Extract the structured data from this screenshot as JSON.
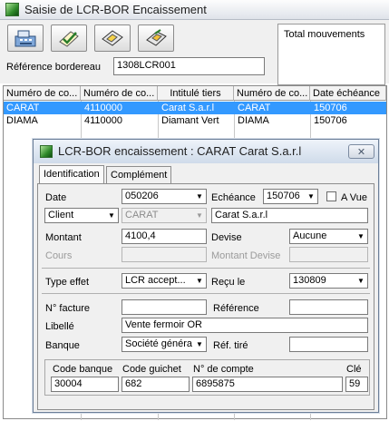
{
  "window": {
    "title": "Saisie de LCR-BOR Encaissement"
  },
  "toolbar": {
    "buttons": [
      {
        "icon": "cash-register-icon"
      },
      {
        "icon": "check-validate-icon"
      },
      {
        "icon": "diskette-icon"
      },
      {
        "icon": "print-icon"
      }
    ],
    "total_label": "Total mouvements"
  },
  "reference": {
    "label": "Référence bordereau",
    "value": "1308LCR001"
  },
  "grid": {
    "columns": [
      "Numéro de co...",
      "Numéro de co...",
      "Intitulé tiers",
      "Numéro de co...",
      "Date échéance"
    ],
    "rows": [
      {
        "cells": [
          "CARAT",
          "4110000",
          "Carat S.a.r.l",
          "CARAT",
          "150706"
        ],
        "selected": true
      },
      {
        "cells": [
          "DIAMA",
          "4110000",
          "Diamant Vert",
          "DIAMA",
          "150706"
        ],
        "selected": false
      }
    ]
  },
  "dialog": {
    "title": "LCR-BOR encaissement : CARAT Carat S.a.r.l",
    "close_label": "✕",
    "tabs": [
      {
        "label": "Identification",
        "active": true
      },
      {
        "label": "Complément",
        "active": false
      }
    ],
    "fields": {
      "date_label": "Date",
      "date_value": "050206",
      "echeance_label": "Echéance",
      "echeance_value": "150706",
      "a_vue_label": "A Vue",
      "a_vue_checked": false,
      "tiers_type": "Client",
      "tiers_code": "CARAT",
      "tiers_name": "Carat S.a.r.l",
      "montant_label": "Montant",
      "montant_value": "4100,4",
      "devise_label": "Devise",
      "devise_value": "Aucune",
      "cours_label": "Cours",
      "cours_value": "",
      "montant_devise_label": "Montant Devise",
      "montant_devise_value": "",
      "type_effet_label": "Type effet",
      "type_effet_value": "LCR accept...",
      "recu_le_label": "Reçu le",
      "recu_le_value": "130809",
      "facture_label": "N° facture",
      "facture_value": "",
      "reference_label": "Référence",
      "reference_value": "",
      "libelle_label": "Libellé",
      "libelle_value": "Vente fermoir OR",
      "banque_label": "Banque",
      "banque_value": "Société généra",
      "ref_tire_label": "Réf. tiré",
      "ref_tire_value": "",
      "code_banque_label": "Code banque",
      "code_banque_value": "30004",
      "code_guichet_label": "Code guichet",
      "code_guichet_value": "682",
      "compte_label": "N° de compte",
      "compte_value": "6895875",
      "cle_label": "Clé",
      "cle_value": "59"
    }
  },
  "colors": {
    "selection": "#3399ff",
    "dialog_title": "#cfdbea",
    "app_icon": "#2f8a2a"
  }
}
